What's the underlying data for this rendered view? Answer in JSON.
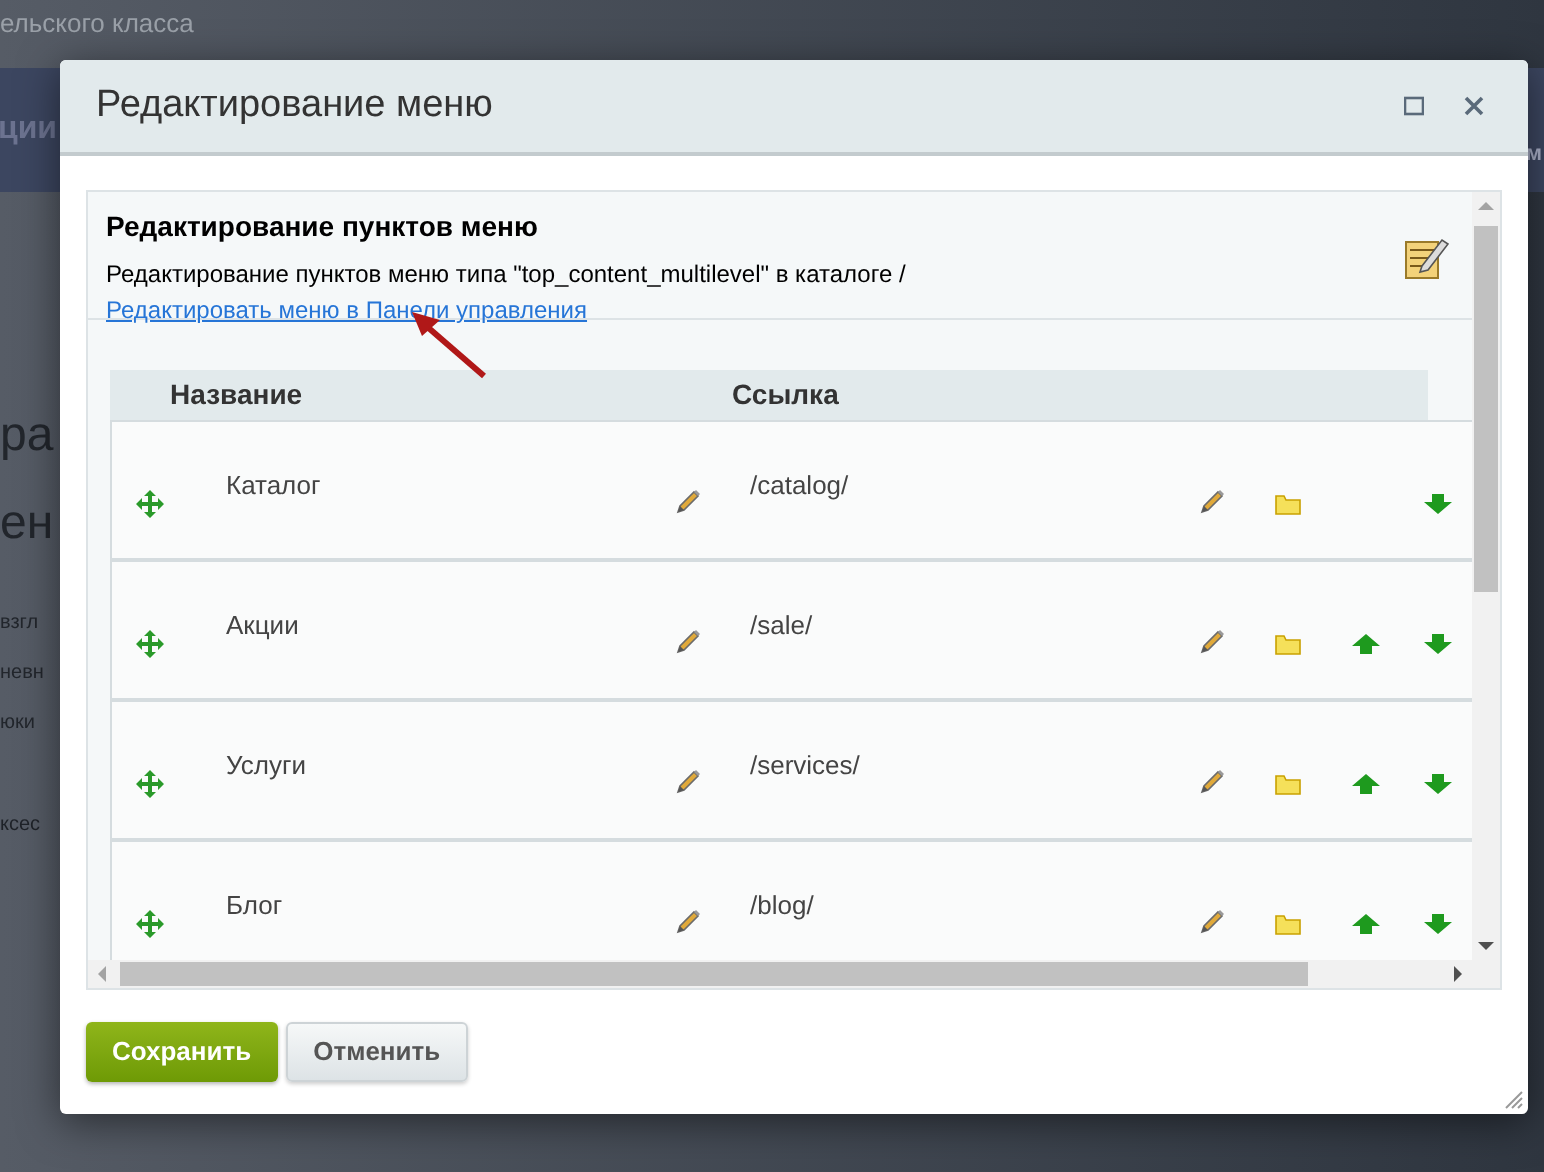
{
  "background": {
    "top_text": "ельского класса",
    "band_left": "ции",
    "band_right": "м",
    "heading_lines": [
      "ра",
      "ен"
    ],
    "text_lines": [
      "взгл",
      "невн",
      "юки"
    ],
    "bottom_text": "ксес"
  },
  "dialog": {
    "title": "Редактирование меню"
  },
  "section": {
    "title": "Редактирование пунктов меню",
    "description": "Редактирование пунктов меню типа \"top_content_multilevel\" в каталоге /",
    "link": "Редактировать меню в Панели управления"
  },
  "table": {
    "columns": [
      "Название",
      "Ссылка"
    ],
    "rows": [
      {
        "name": "Каталог",
        "link": "/catalog/",
        "can_move_up": false
      },
      {
        "name": "Акции",
        "link": "/sale/",
        "can_move_up": true
      },
      {
        "name": "Услуги",
        "link": "/services/",
        "can_move_up": true
      },
      {
        "name": "Блог",
        "link": "/blog/",
        "can_move_up": true
      }
    ]
  },
  "buttons": [
    {
      "label": "Сохранить",
      "kind": "primary"
    },
    {
      "label": "Отменить",
      "kind": "secondary"
    }
  ]
}
